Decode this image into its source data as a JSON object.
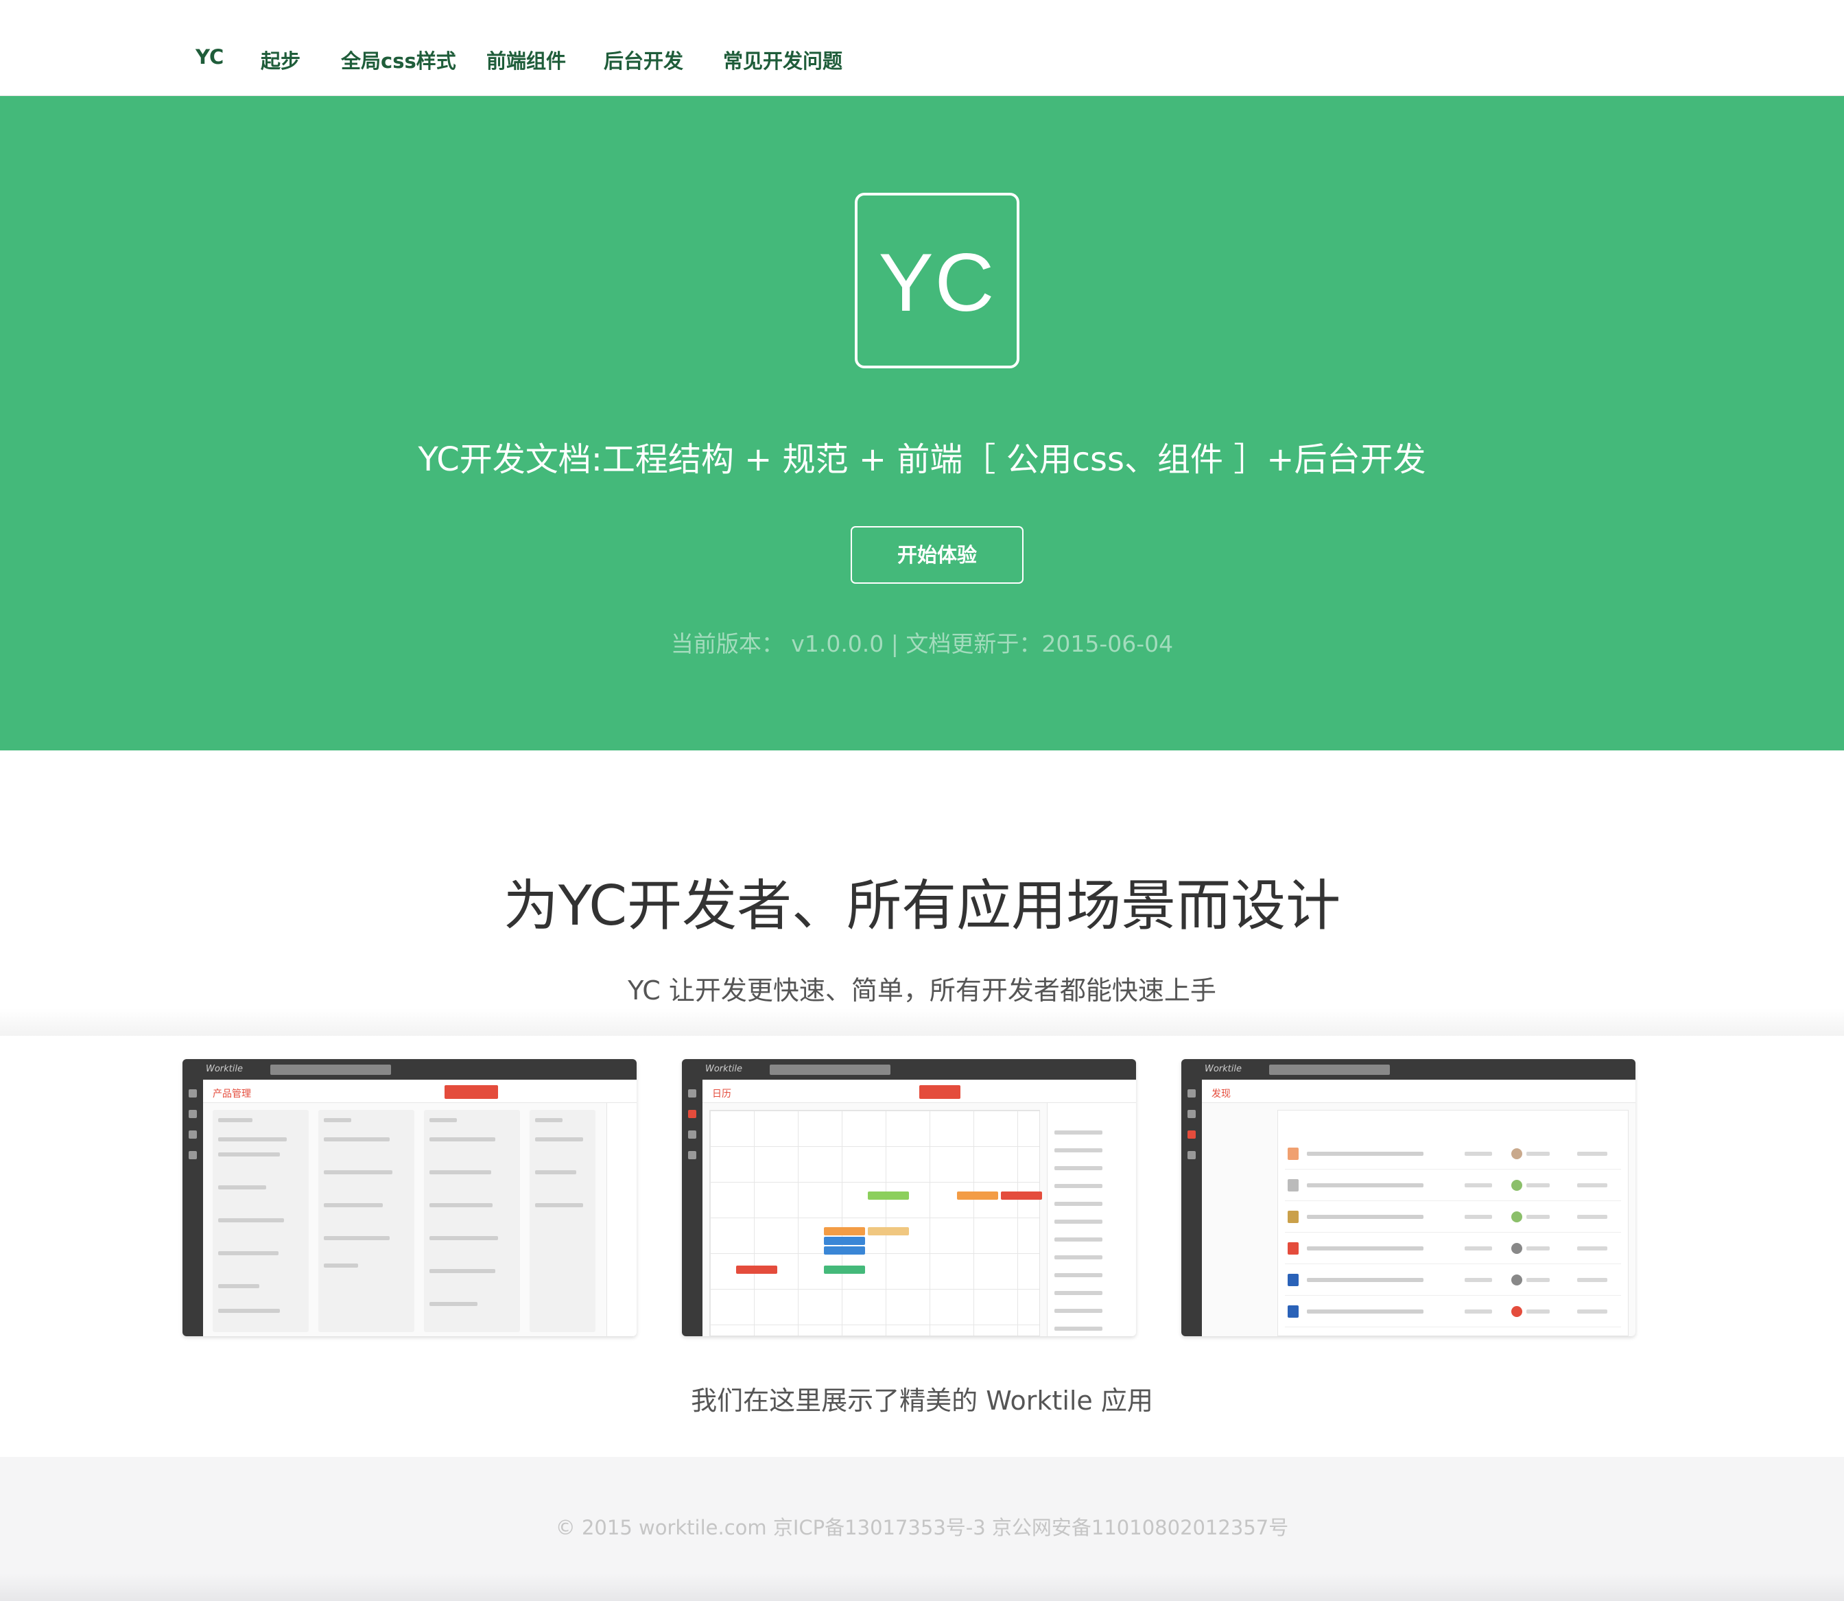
{
  "nav": {
    "items": [
      "YC",
      "起步",
      "全局css样式",
      "前端组件",
      "后台开发",
      "常见开发问题"
    ]
  },
  "hero": {
    "logo_text": "YC",
    "title": "YC开发文档:工程结构 + 规范 + 前端［ 公用css、组件 ］+后台开发",
    "button_label": "开始体验",
    "version_line": "当前版本： v1.0.0.0 | 文档更新于：2015-06-04",
    "background_color": "#44b97a"
  },
  "feature": {
    "title": "为YC开发者、所有应用场景而设计",
    "subtitle": "YC 让开发更快速、简单，所有开发者都能快速上手",
    "caption": "我们在这里展示了精美的 Worktile 应用"
  },
  "screenshots": [
    {
      "brand": "Worktile",
      "section_title": "产品管理",
      "icon": "kanban-screenshot"
    },
    {
      "brand": "Worktile",
      "section_title": "日历",
      "icon": "calendar-screenshot"
    },
    {
      "brand": "Worktile",
      "section_title": "发现",
      "icon": "files-screenshot"
    }
  ],
  "footer": {
    "copyright": "© 2015 worktile.com 京ICP备13017353号-3 京公网安备11010802012357号"
  },
  "colors": {
    "accent": "#44b97a",
    "nav_text": "#1f5d3a",
    "danger": "#e44c3c"
  }
}
